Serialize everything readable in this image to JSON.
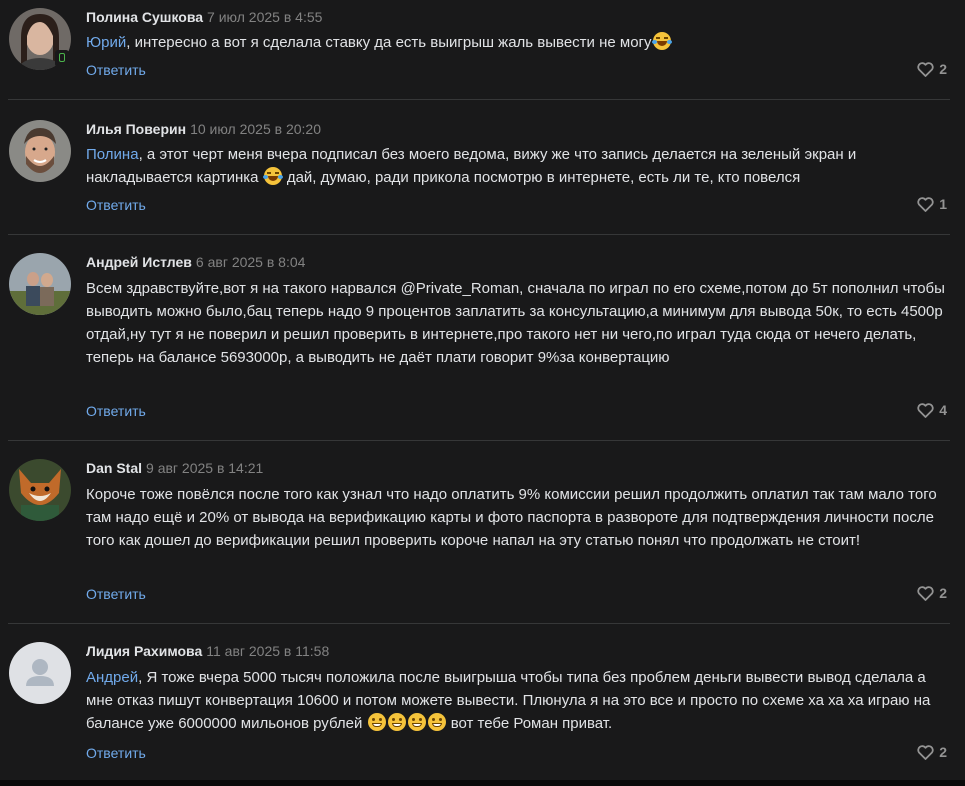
{
  "reply_label": "Ответить",
  "colors": {
    "background": "#19191a",
    "accent": "#71aaeb",
    "divider": "#363738"
  },
  "comments": [
    {
      "author": "Полина Сушкова",
      "date": "7 июл 2025 в 4:55",
      "mention": "Юрий",
      "text": ", интересно а вот я сделала ставку да есть выигрыш жаль вывести не могу",
      "likes": "2",
      "online_mobile": true
    },
    {
      "author": "Илья Поверин",
      "date": "10 июл 2025 в 20:20",
      "mention": "Полина",
      "text_a": ", а этот черт меня вчера подписал без моего ведома, вижу же что запись делается на зеленый экран и накладывается картинка",
      "text_b": " дай, думаю, ради прикола посмотрю в интернете, есть ли те, кто повелся",
      "likes": "1"
    },
    {
      "author": "Андрей Истлев",
      "date": "6 авг 2025 в 8:04",
      "text": "Всем здравствуйте,вот я на такого нарвался @Private_Roman, сначала по играл по его схеме,потом до 5т пополнил чтобы выводить можно было,бац теперь надо 9 процентов заплатить за консультацию,а минимум для вывода 50к, то есть 4500р отдай,ну тут я не поверил и решил проверить в интернете,про такого нет ни чего,по играл туда сюда от нечего делать, теперь на балансе 5693000р, а выводить не даёт плати говорит 9%за конвертацию",
      "likes": "4"
    },
    {
      "author": "Dan Stal",
      "date": "9 авг 2025 в 14:21",
      "text": "Короче тоже повёлся после того как узнал что надо оплатить 9% комиссии решил продолжить оплатил так там мало того там надо ещё и 20% от вывода на верификацию карты и фото паспорта в развороте для подтверждения личности после того как дошел до верификации решил проверить короче напал на эту статью понял что продолжать не стоит!",
      "likes": "2"
    },
    {
      "author": "Лидия Рахимова",
      "date": "11 авг 2025 в 11:58",
      "mention": "Андрей",
      "text_a": ", Я тоже вчера 5000 тысяч положила после выигрыша чтобы типа без проблем деньги вывести вывод сделала а мне отказ пишут конвертация 10600 и потом можете вывести. Плюнула я на это все и просто по схеме ха ха ха играю на балансе уже 6000000 мильонов рублей",
      "text_b": " вот тебе Роман приват.",
      "likes": "2"
    }
  ]
}
